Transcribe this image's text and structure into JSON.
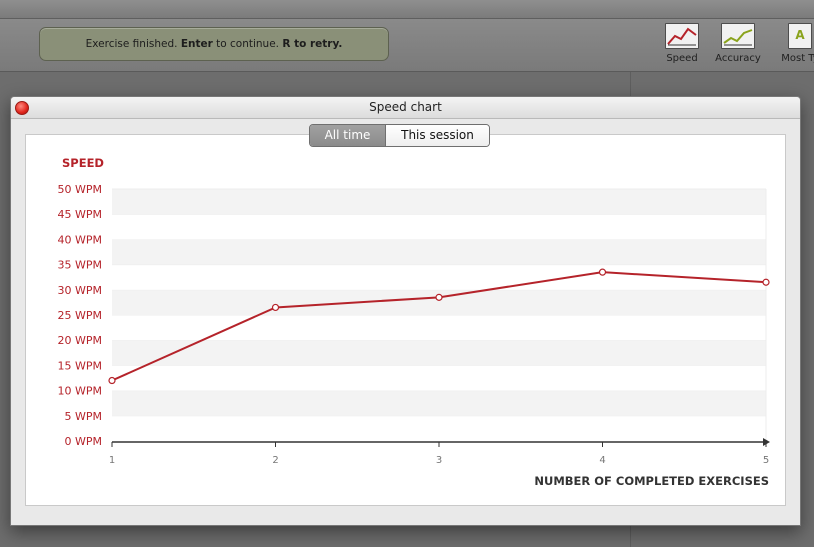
{
  "status": {
    "part1": "Exercise finished. ",
    "enter": "Enter",
    "part2": " to continue. ",
    "retry": "R to retry."
  },
  "toolbar": {
    "speed_label": "Speed",
    "accuracy_label": "Accuracy",
    "most_label": "Most Ty",
    "most_icon_letter": "A"
  },
  "dialog": {
    "title": "Speed chart",
    "tabs": [
      "All time",
      "This session"
    ],
    "selected_tab": "All time"
  },
  "colors": {
    "accent": "#b5232a",
    "axis": "#333333",
    "grid_band": "#f3f3f3"
  },
  "chart_data": {
    "type": "line",
    "ylabel": "SPEED",
    "xlabel": "NUMBER OF COMPLETED EXERCISES",
    "y_ticks": [
      "0 WPM",
      "5 WPM",
      "10 WPM",
      "15 WPM",
      "20 WPM",
      "25 WPM",
      "30 WPM",
      "35 WPM",
      "40 WPM",
      "45 WPM",
      "50 WPM"
    ],
    "x_ticks": [
      "1",
      "2",
      "3",
      "4",
      "5"
    ],
    "ylim": [
      0,
      50
    ],
    "xlim": [
      1,
      5
    ],
    "series": [
      {
        "x": [
          1,
          2,
          3,
          4,
          5
        ],
        "values": [
          12,
          26.5,
          28.5,
          33.5,
          31.5
        ]
      }
    ]
  }
}
